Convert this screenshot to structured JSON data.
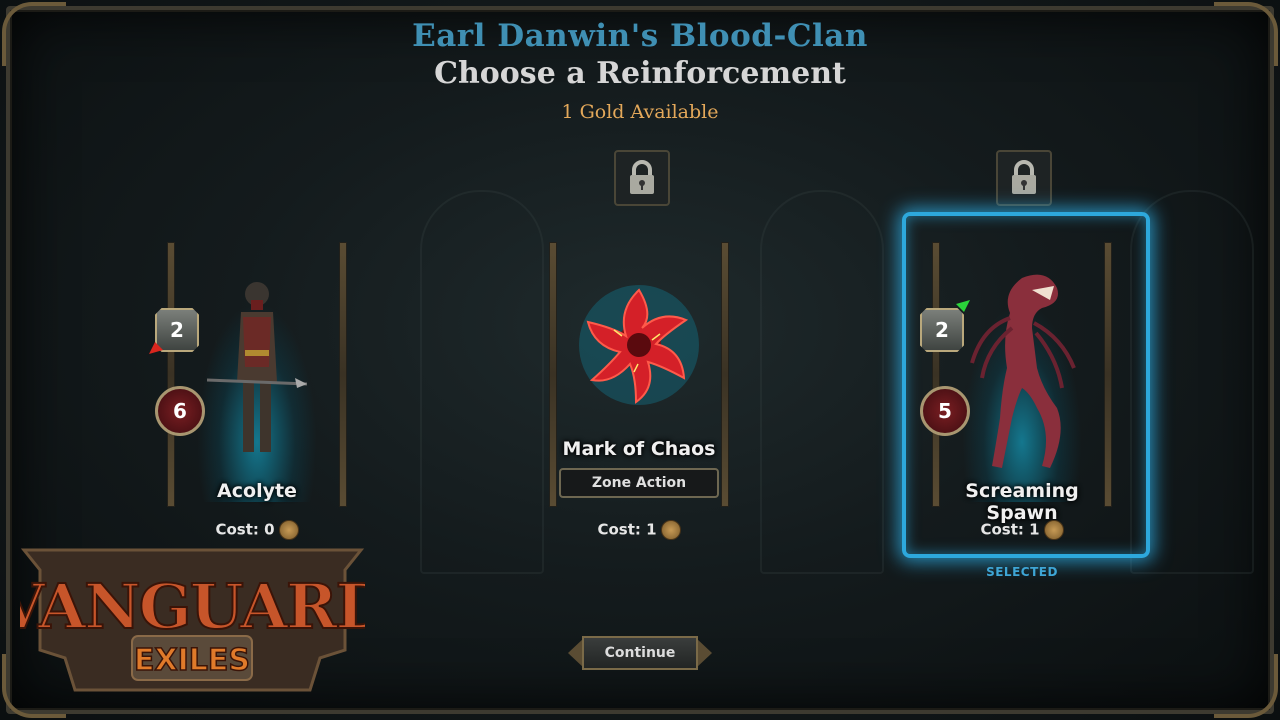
{
  "header": {
    "clan_name": "Earl Danwin's Blood-Clan",
    "title": "Choose a Reinforcement",
    "gold": "1 Gold Available"
  },
  "cards": [
    {
      "name": "Acolyte",
      "attack": "2",
      "health": "6",
      "cost": "Cost: 0",
      "locked": false
    },
    {
      "name": "Mark of Chaos",
      "tag": "Zone Action",
      "cost": "Cost: 1",
      "locked": true
    },
    {
      "name": "Screaming Spawn",
      "attack": "2",
      "health": "5",
      "cost": "Cost: 1",
      "locked": true,
      "selected": true
    }
  ],
  "selected_label": "SELECTED",
  "continue_label": "Continue",
  "logo": {
    "line1": "VANGUARD",
    "line2": "EXILES"
  },
  "colors": {
    "accent": "#2da8dc",
    "clan": "#3f8fb3",
    "gold": "#e3a85a"
  }
}
